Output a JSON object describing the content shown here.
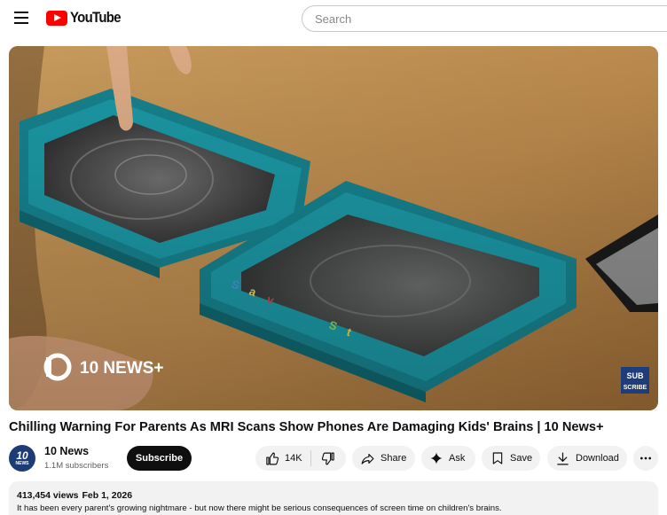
{
  "header": {
    "logo_text": "YouTube",
    "search_placeholder": "Search"
  },
  "player": {
    "watermark": "10 NEWS+",
    "corner_badge": "SUB SCRIBE"
  },
  "video": {
    "title": "Chilling Warning For Parents As MRI Scans Show Phones Are Damaging Kids' Brains | 10 News+"
  },
  "channel": {
    "name": "10 News",
    "subscribers": "1.1M subscribers",
    "avatar_text": "10",
    "avatar_subtext": "NEWS"
  },
  "actions": {
    "subscribe_label": "Subscribe",
    "like_count": "14K",
    "share_label": "Share",
    "ask_label": "Ask",
    "save_label": "Save",
    "download_label": "Download"
  },
  "description": {
    "views": "413,454 views",
    "date": "Feb 1, 2026",
    "text": "It has been every parent's growing nightmare - but now there might be serious consequences of screen time on children's brains."
  },
  "colors": {
    "brand": "#ff0000",
    "subscribe_bg": "#0f0f0f",
    "pill_bg": "#f2f2f2",
    "frame_teal": "#1b8f9b"
  },
  "icons": [
    "menu-icon",
    "youtube-logo-icon",
    "thumbs-up-icon",
    "thumbs-down-icon",
    "share-icon",
    "sparkle-icon",
    "bookmark-icon",
    "download-icon",
    "more-icon"
  ]
}
